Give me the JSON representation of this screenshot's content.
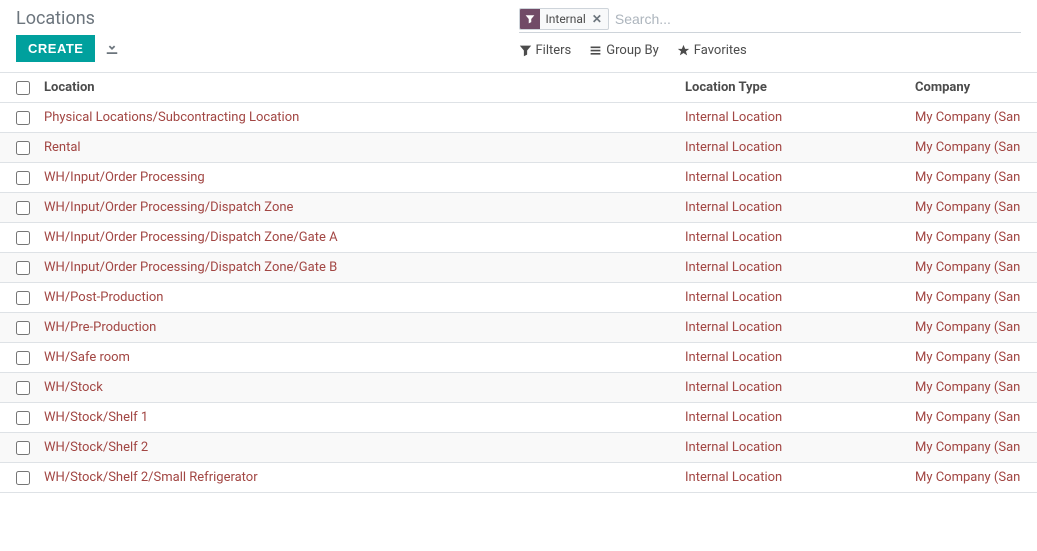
{
  "header": {
    "title": "Locations",
    "create_label": "CREATE"
  },
  "search": {
    "facet_label": "Internal",
    "placeholder": "Search...",
    "filters_label": "Filters",
    "groupby_label": "Group By",
    "favorites_label": "Favorites"
  },
  "table": {
    "col_location": "Location",
    "col_type": "Location Type",
    "col_company": "Company",
    "rows": [
      {
        "location": "Physical Locations/Subcontracting Location",
        "type": "Internal Location",
        "company": "My Company (San"
      },
      {
        "location": "Rental",
        "type": "Internal Location",
        "company": "My Company (San"
      },
      {
        "location": "WH/Input/Order Processing",
        "type": "Internal Location",
        "company": "My Company (San"
      },
      {
        "location": "WH/Input/Order Processing/Dispatch Zone",
        "type": "Internal Location",
        "company": "My Company (San"
      },
      {
        "location": "WH/Input/Order Processing/Dispatch Zone/Gate A",
        "type": "Internal Location",
        "company": "My Company (San"
      },
      {
        "location": "WH/Input/Order Processing/Dispatch Zone/Gate B",
        "type": "Internal Location",
        "company": "My Company (San"
      },
      {
        "location": "WH/Post-Production",
        "type": "Internal Location",
        "company": "My Company (San"
      },
      {
        "location": "WH/Pre-Production",
        "type": "Internal Location",
        "company": "My Company (San"
      },
      {
        "location": "WH/Safe room",
        "type": "Internal Location",
        "company": "My Company (San"
      },
      {
        "location": "WH/Stock",
        "type": "Internal Location",
        "company": "My Company (San"
      },
      {
        "location": "WH/Stock/Shelf 1",
        "type": "Internal Location",
        "company": "My Company (San"
      },
      {
        "location": "WH/Stock/Shelf 2",
        "type": "Internal Location",
        "company": "My Company (San"
      },
      {
        "location": "WH/Stock/Shelf 2/Small Refrigerator",
        "type": "Internal Location",
        "company": "My Company (San"
      }
    ]
  }
}
